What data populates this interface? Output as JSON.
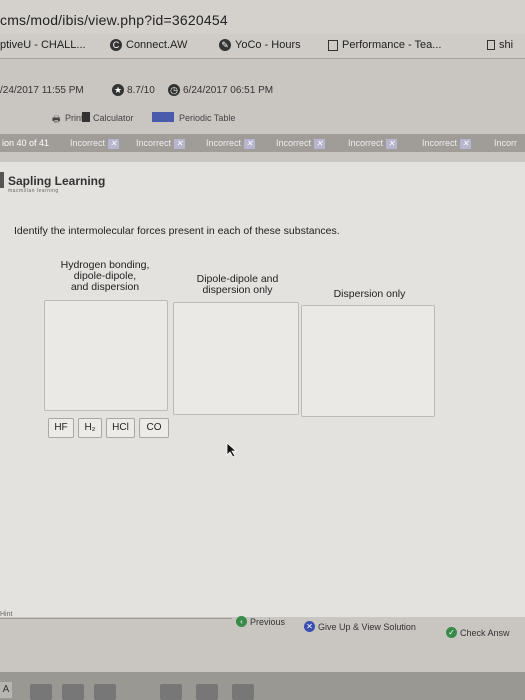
{
  "browser": {
    "url": "cms/mod/ibis/view.php?id=3620454",
    "bookmarks": [
      {
        "label": "ptiveU - CHALL...",
        "icon": "none"
      },
      {
        "label": "Connect.AW",
        "icon": "c-circle-icon"
      },
      {
        "label": "YoCo - Hours",
        "icon": "tag-circle-icon"
      },
      {
        "label": "Performance - Tea...",
        "icon": "bookmark-square-icon"
      },
      {
        "label": "shi",
        "icon": "page-icon"
      }
    ]
  },
  "assignment": {
    "open_date": "/24/2017 11:55 PM",
    "score": "8.7/10",
    "due_date": "6/24/2017 06:51 PM"
  },
  "toolbar": {
    "print": "Print",
    "calculator": "Calculator",
    "periodic_table": "Periodic Table"
  },
  "question_nav": {
    "position": "ion 40 of 41",
    "statuses": [
      "Incorrect",
      "Incorrect",
      "Incorrect",
      "Incorrect",
      "Incorrect",
      "Incorrect",
      "Incorr"
    ]
  },
  "logo": {
    "title": "Sapling Learning",
    "subtitle": "macmillan learning"
  },
  "question": {
    "prompt": "Identify the intermolecular forces present in each of these substances.",
    "categories": [
      {
        "line1": "Hydrogen bonding,",
        "line2": "dipole-dipole,",
        "line3": "and dispersion"
      },
      {
        "line1": "Dipole-dipole and",
        "line2": "dispersion only",
        "line3": ""
      },
      {
        "line1": "Dispersion only",
        "line2": "",
        "line3": ""
      }
    ],
    "choices": [
      "HF",
      "H₂",
      "HCl",
      "CO"
    ]
  },
  "footer": {
    "hint": "Hint",
    "previous": "Previous",
    "give_up": "Give Up & View Solution",
    "check": "Check Answ"
  },
  "taskbar": {
    "start": "A"
  }
}
